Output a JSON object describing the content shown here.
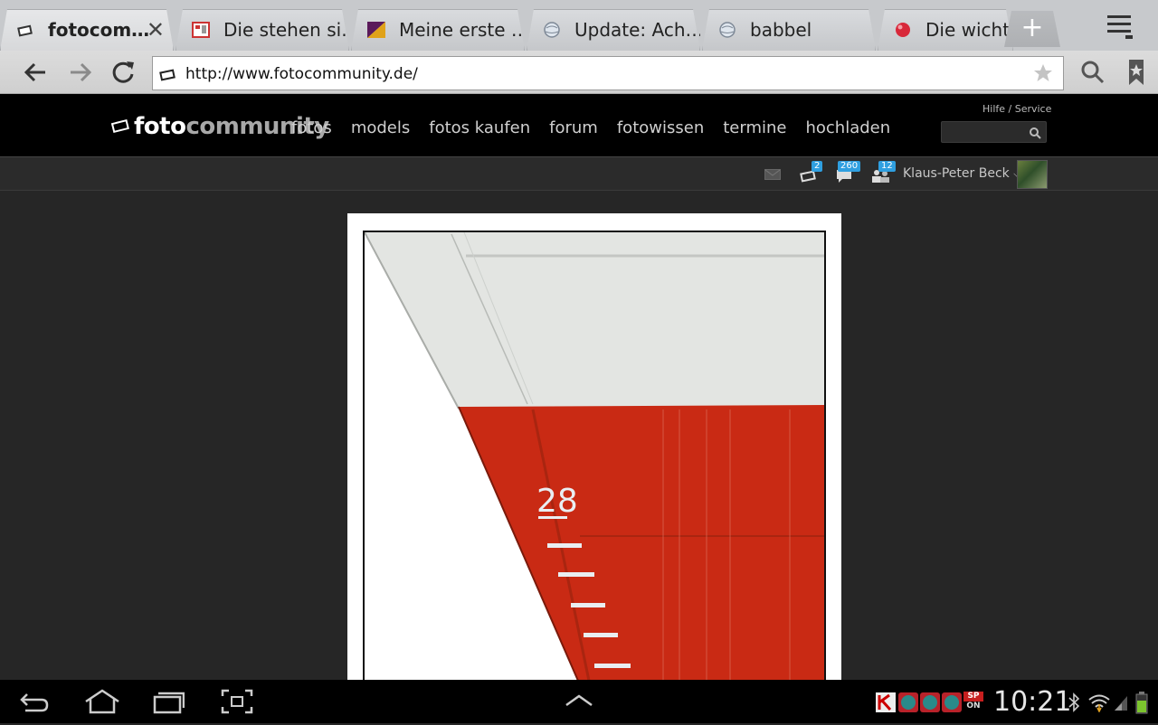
{
  "browser": {
    "tabs": [
      {
        "title": "fotocom…",
        "active": true,
        "icon": "fotocommunity-favicon"
      },
      {
        "title": "Die stehen si…",
        "active": false,
        "icon": "news-favicon"
      },
      {
        "title": "Meine erste …",
        "active": false,
        "icon": "flag-favicon"
      },
      {
        "title": "Update: Ach…",
        "active": false,
        "icon": "globe-favicon"
      },
      {
        "title": "babbel",
        "active": false,
        "icon": "globe-favicon"
      },
      {
        "title": "Die wichtig",
        "active": false,
        "icon": "red-ball-favicon"
      }
    ],
    "new_tab_label": "+",
    "url": "http://www.fotocommunity.de/"
  },
  "site": {
    "logo": {
      "part1": "foto",
      "part2": "community"
    },
    "nav": [
      "fotos",
      "models",
      "fotos kaufen",
      "forum",
      "fotowissen",
      "termine",
      "hochladen"
    ],
    "help_link": "Hilfe / Service",
    "search_placeholder": ""
  },
  "userbar": {
    "message_icon": "envelope-icon",
    "camera_count": "2",
    "comments_count": "260",
    "friends_count": "12",
    "username": "Klaus-Peter Beck"
  },
  "photo": {
    "draft_number": "28",
    "colors": {
      "hull_white": "#e3e5e2",
      "hull_red": "#c92a14"
    }
  },
  "statusbar": {
    "time": "10:21",
    "sp_label": "SP",
    "on_label": "ON"
  }
}
